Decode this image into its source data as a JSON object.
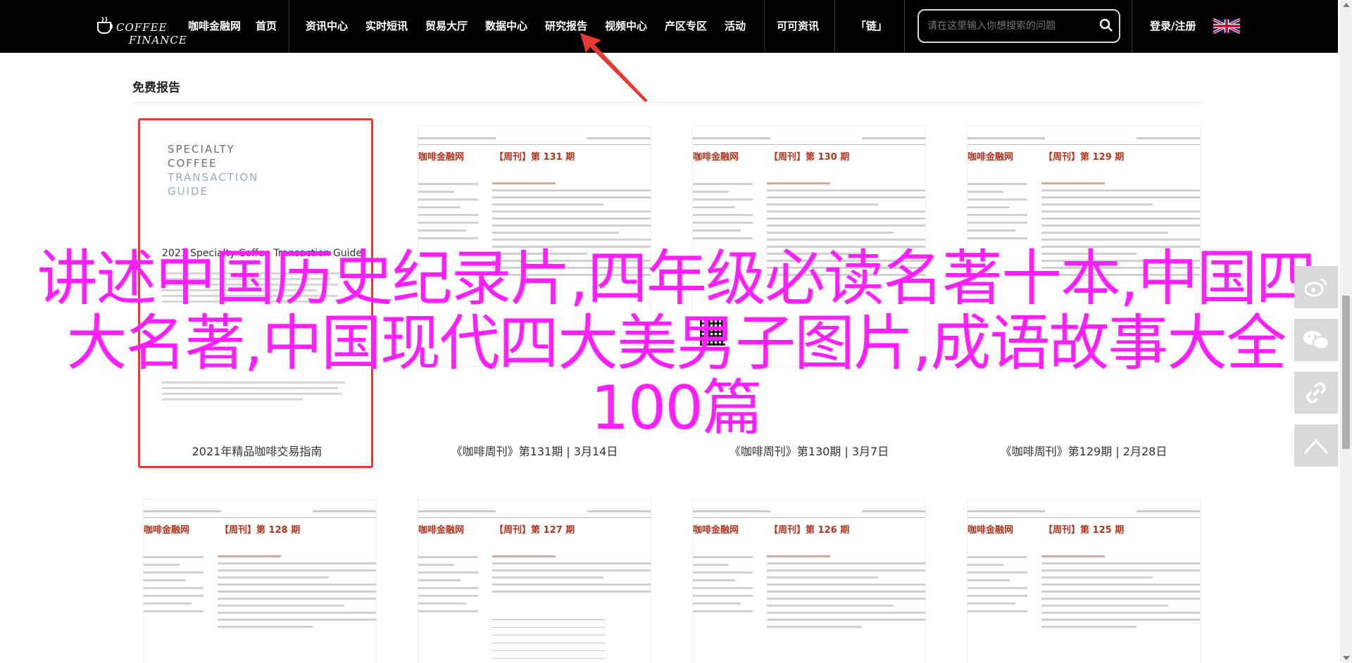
{
  "header": {
    "logo_line1": "COFFEE",
    "logo_line2": "FINANCE",
    "nav": [
      "咖啡金融网",
      "首页",
      "资讯中心",
      "实时短讯",
      "贸易大厅",
      "数据中心",
      "研究报告",
      "视频中心",
      "产区专区",
      "活动",
      "可可资讯",
      "「链」"
    ],
    "search_placeholder": "请在这里输入你想搜索的问题",
    "login": "登录/注册"
  },
  "section": {
    "title": "免费报告"
  },
  "cover": {
    "lines": [
      "SPECIALTY",
      "COFFEE",
      "TRANSACTION",
      "GUIDE"
    ],
    "headline": "2021 Specialty Coffee Transaction Guide"
  },
  "docs": {
    "brand": "咖啡金融网",
    "issues": [
      "【周刊】第 131 期",
      "【周刊】第 130 期",
      "【周刊】第 129 期",
      "【周刊】第 128 期",
      "【周刊】第 127 期",
      "【周刊】第 126 期",
      "【周刊】第 125 期"
    ]
  },
  "captions": [
    "2021年精品咖啡交易指南",
    "《咖啡周刊》第131期 | 3月14日",
    "《咖啡周刊》第130期 | 3月7日",
    "《咖啡周刊》第129期 | 2月28日"
  ],
  "overlay_text": "讲述中国历史纪录片,四年级必读名著十本,中国四大名著,中国现代四大美男子图片,成语故事大全100篇",
  "colors": {
    "accent_red": "#e63a32",
    "brand_red": "#b2341e",
    "overlay_magenta": "#ff1fff",
    "nav_bg": "#000000"
  },
  "share_rail": [
    "weibo-icon",
    "wechat-icon",
    "link-icon",
    "back-to-top-icon"
  ]
}
